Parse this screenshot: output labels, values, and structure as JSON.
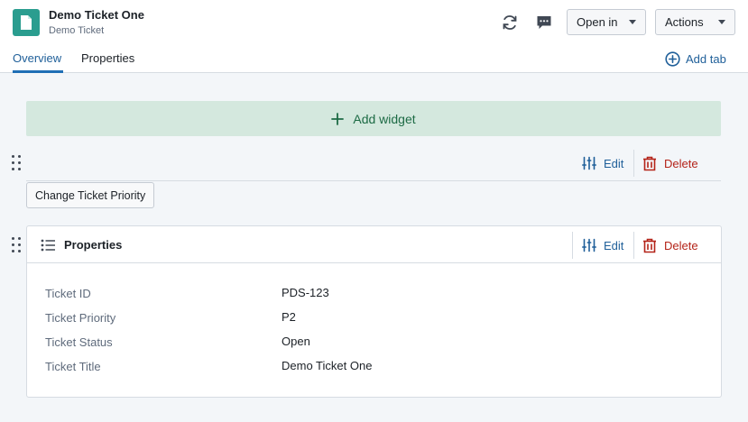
{
  "header": {
    "title": "Demo Ticket One",
    "subtitle": "Demo Ticket",
    "open_in_label": "Open in",
    "actions_label": "Actions",
    "icons": [
      "object-icon",
      "refresh-icon",
      "comment-icon"
    ]
  },
  "tabs": [
    {
      "label": "Overview",
      "active": true
    },
    {
      "label": "Properties",
      "active": false
    }
  ],
  "add_tab_label": "Add tab",
  "add_widget_label": "Add widget",
  "widget_actions": {
    "edit": "Edit",
    "delete": "Delete"
  },
  "button_widget": {
    "label": "Change Ticket Priority"
  },
  "properties_card": {
    "title": "Properties",
    "rows": [
      {
        "label": "Ticket ID",
        "value": "PDS-123"
      },
      {
        "label": "Ticket Priority",
        "value": "P2"
      },
      {
        "label": "Ticket Status",
        "value": "Open"
      },
      {
        "label": "Ticket Title",
        "value": "Demo Ticket One"
      }
    ]
  },
  "colors": {
    "accent": "#1f6fb5",
    "object_icon": "#2a9d8f",
    "add_widget_bg": "#d4e8de",
    "add_widget_text": "#1d6b45",
    "danger": "#b42318",
    "page_bg": "#f3f6f9"
  }
}
